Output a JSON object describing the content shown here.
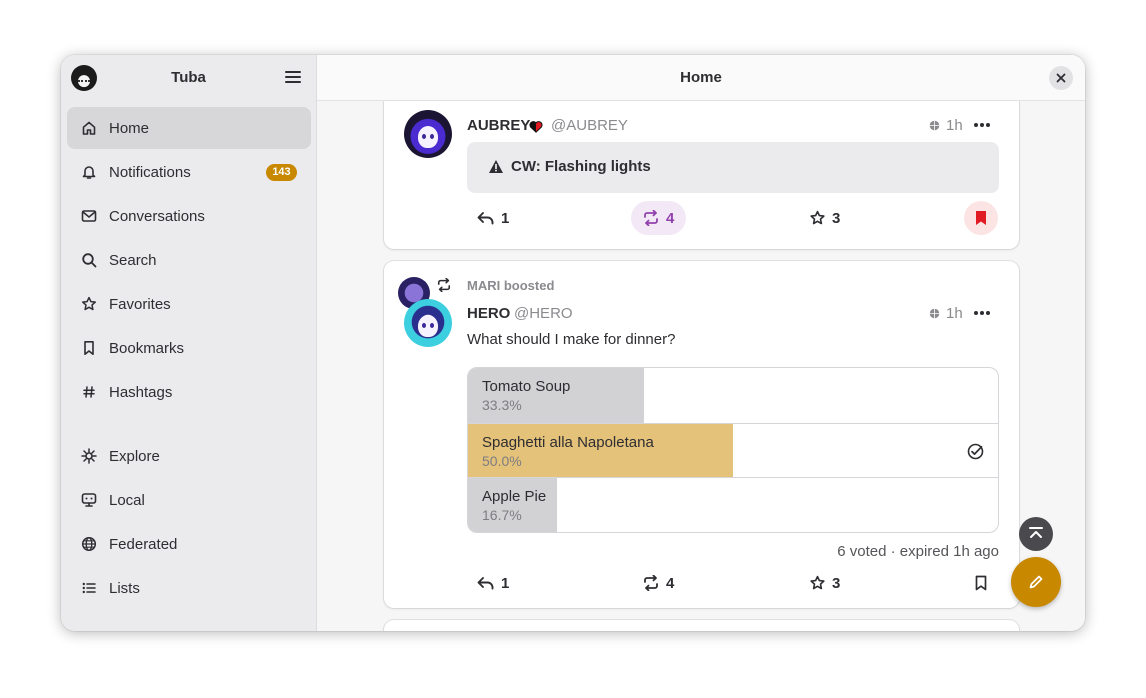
{
  "app": {
    "title": "Tuba"
  },
  "main": {
    "title": "Home"
  },
  "sidebar": {
    "items": [
      {
        "label": "Home",
        "icon": "home-icon",
        "active": true
      },
      {
        "label": "Notifications",
        "icon": "bell-icon",
        "badge": "143"
      },
      {
        "label": "Conversations",
        "icon": "mail-icon"
      },
      {
        "label": "Search",
        "icon": "search-icon"
      },
      {
        "label": "Favorites",
        "icon": "star-icon"
      },
      {
        "label": "Bookmarks",
        "icon": "bookmark-icon"
      },
      {
        "label": "Hashtags",
        "icon": "hashtag-icon"
      },
      {
        "label": "Explore",
        "icon": "explore-icon"
      },
      {
        "label": "Local",
        "icon": "local-icon"
      },
      {
        "label": "Federated",
        "icon": "globe-icon"
      },
      {
        "label": "Lists",
        "icon": "list-icon"
      }
    ]
  },
  "posts": [
    {
      "name": "AUBREY",
      "handle": "@AUBREY",
      "time": "1h",
      "content_warning": "CW: Flashing lights",
      "replies": "1",
      "boosts": "4",
      "favorites": "3",
      "boosted_by_me": true,
      "bookmarked": true
    },
    {
      "boosted_by": "MARI boosted",
      "name": "HERO",
      "handle": "@HERO",
      "time": "1h",
      "text": "What should I make for dinner?",
      "poll": {
        "options": [
          {
            "label": "Tomato Soup",
            "percent": "33.3%",
            "value": 33.3
          },
          {
            "label": "Spaghetti alla Napoletana",
            "percent": "50.0%",
            "value": 50.0,
            "voted": true
          },
          {
            "label": "Apple Pie",
            "percent": "16.7%",
            "value": 16.7
          }
        ],
        "footer": "6 voted · expired 1h ago"
      },
      "replies": "1",
      "boosts": "4",
      "favorites": "3"
    }
  ],
  "colors": {
    "accent": "#c88800",
    "boost_active": "#9141ac",
    "bookmark_active": "#e01b24",
    "poll_winner": "#e5c27a",
    "poll_bar": "#d2d2d4"
  }
}
